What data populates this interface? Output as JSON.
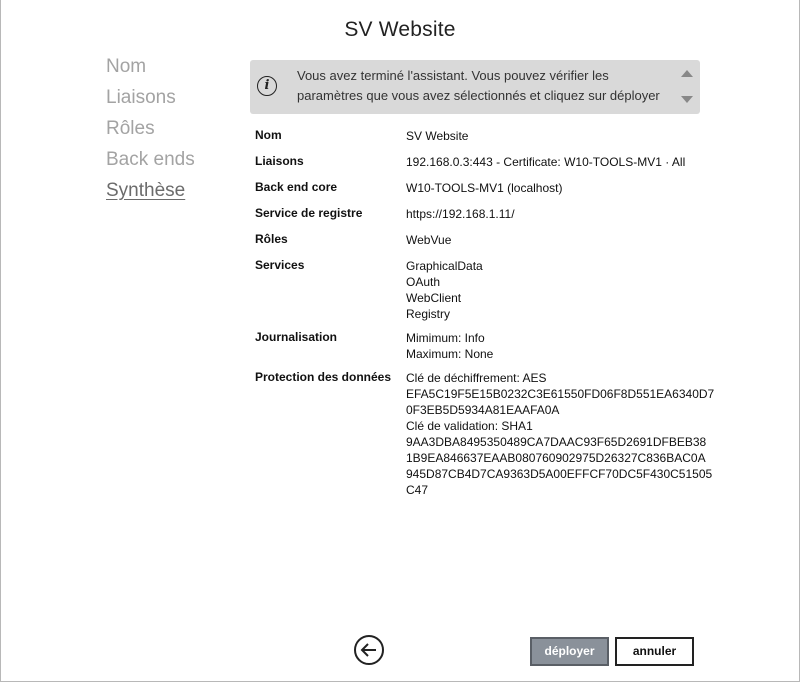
{
  "window": {
    "title": "SV Website"
  },
  "nav": {
    "items": [
      "Nom",
      "Liaisons",
      "Rôles",
      "Back ends",
      "Synthèse"
    ],
    "active": "Synthèse"
  },
  "info": {
    "icon": "info-icon",
    "text": "Vous avez terminé l'assistant. Vous pouvez vérifier les paramètres que vous avez sélectionnés et cliquez sur déployer pour mettre"
  },
  "summary": {
    "nom": {
      "label": "Nom",
      "lines": [
        "SV Website"
      ]
    },
    "liaisons": {
      "label": "Liaisons",
      "lines": [
        "192.168.0.3:443 - Certificate: W10-TOOLS-MV1 · All"
      ]
    },
    "backend": {
      "label": "Back end core",
      "lines": [
        "W10-TOOLS-MV1 (localhost)"
      ]
    },
    "registre": {
      "label": "Service de registre",
      "lines": [
        "https://192.168.1.11/"
      ]
    },
    "roles": {
      "label": "Rôles",
      "lines": [
        "WebVue"
      ]
    },
    "services": {
      "label": "Services",
      "lines": [
        "GraphicalData",
        "OAuth",
        "WebClient",
        "Registry"
      ]
    },
    "journal": {
      "label": "Journalisation",
      "lines": [
        "Mimimum: Info",
        "Maximum: None"
      ]
    },
    "protection": {
      "label": "Protection des données",
      "lines": [
        "Clé de déchiffrement: AES",
        "EFA5C19F5E15B0232C3E61550FD06F8D551EA6340D7",
        "0F3EB5D5934A81EAAFA0A",
        "Clé de validation: SHA1",
        "9AA3DBA8495350489CA7DAAC93F65D2691DFBEB38",
        "1B9EA846637EAAB080760902975D26327C836BAC0A",
        "945D87CB4D7CA9363D5A00EFFCF70DC5F430C51505",
        "C47"
      ]
    }
  },
  "footer": {
    "back_icon": "back-arrow-icon",
    "deploy_label": "déployer",
    "cancel_label": "annuler"
  }
}
